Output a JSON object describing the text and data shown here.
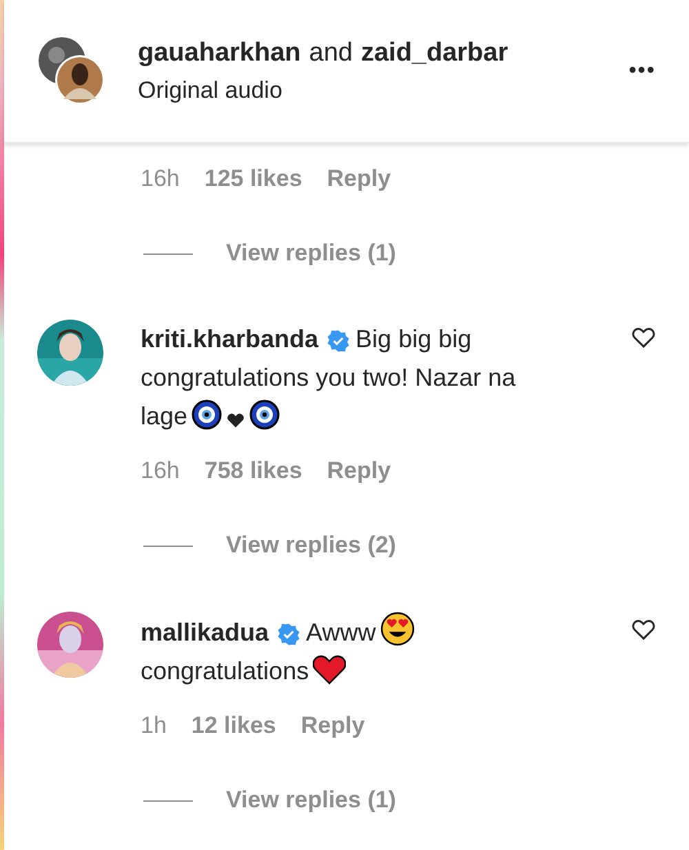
{
  "header": {
    "user_1": "gauaharkhan",
    "joiner": "and",
    "user_2": "zaid_darbar",
    "subtitle": "Original audio",
    "menu": "•••"
  },
  "comments": [
    {
      "time": "16h",
      "likes": "125 likes",
      "reply": "Reply",
      "view_replies": "View replies (1)"
    },
    {
      "username": "kriti.kharbanda",
      "verified": true,
      "text": "Big big big congratulations you two! Nazar na lage",
      "emojis": [
        {
          "kind": "evil-eye"
        },
        {
          "kind": "black-heart"
        },
        {
          "kind": "evil-eye"
        }
      ],
      "time": "16h",
      "likes": "758 likes",
      "reply": "Reply",
      "view_replies": "View replies (2)"
    },
    {
      "username": "mallikadua",
      "verified": true,
      "text": "Awww",
      "emojis": [
        {
          "kind": "heart-eyes"
        }
      ],
      "text_2": "congratulations",
      "emojis_2": [
        {
          "kind": "heart"
        }
      ],
      "time": "1h",
      "likes": "12 likes",
      "reply": "Reply",
      "view_replies": "View replies (1)"
    }
  ]
}
